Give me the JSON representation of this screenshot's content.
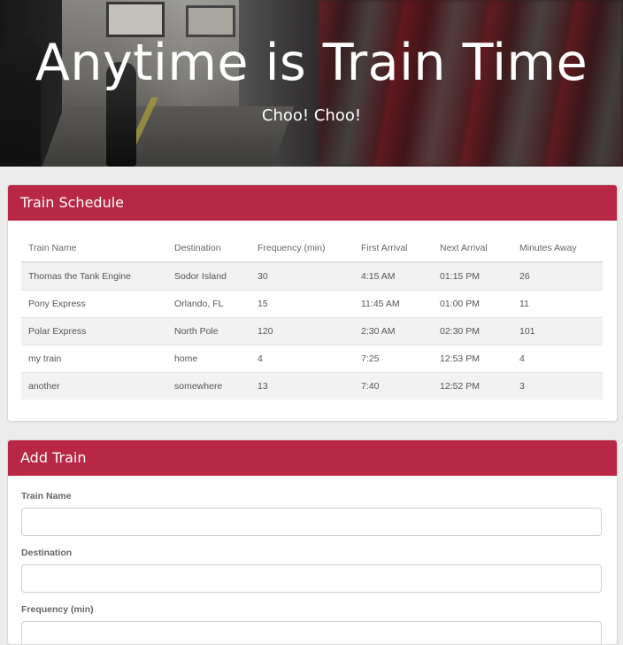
{
  "hero": {
    "title": "Anytime is Train Time",
    "subtitle": "Choo! Choo!"
  },
  "schedule": {
    "heading": "Train Schedule",
    "columns": [
      "Train Name",
      "Destination",
      "Frequency (min)",
      "First Arrival",
      "Next Arrival",
      "Minutes Away"
    ],
    "rows": [
      [
        "Thomas the Tank Engine",
        "Sodor Island",
        "30",
        "4:15 AM",
        "01:15 PM",
        "26"
      ],
      [
        "Pony Express",
        "Orlando, FL",
        "15",
        "11:45 AM",
        "01:00 PM",
        "11"
      ],
      [
        "Polar Express",
        "North Pole",
        "120",
        "2:30 AM",
        "02:30 PM",
        "101"
      ],
      [
        "my train",
        "home",
        "4",
        "7:25",
        "12:53 PM",
        "4"
      ],
      [
        "another",
        "somewhere",
        "13",
        "7:40",
        "12:52 PM",
        "3"
      ]
    ]
  },
  "add_train": {
    "heading": "Add Train",
    "fields": [
      {
        "label": "Train Name",
        "value": ""
      },
      {
        "label": "Destination",
        "value": ""
      },
      {
        "label": "Frequency (min)",
        "value": ""
      }
    ]
  },
  "colors": {
    "accent": "#b82743",
    "stripe": "#f2f2f2"
  }
}
